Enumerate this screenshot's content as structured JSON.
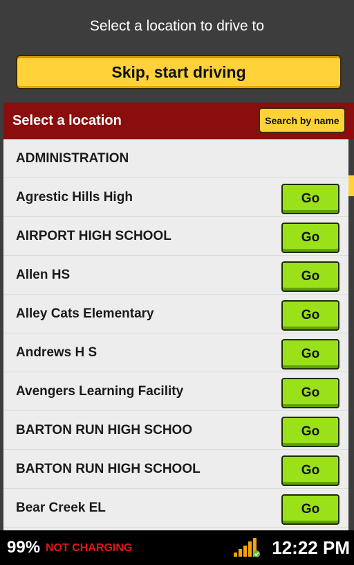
{
  "header": {
    "title": "Select a location to drive to",
    "skip_label": "Skip, start driving"
  },
  "location_bar": {
    "title": "Select a location",
    "search_label": "Search by name"
  },
  "locations": [
    {
      "name": "ADMINISTRATION",
      "go": ""
    },
    {
      "name": "Agrestic Hills High",
      "go": "Go"
    },
    {
      "name": "AIRPORT HIGH SCHOOL",
      "go": "Go"
    },
    {
      "name": "Allen HS",
      "go": "Go"
    },
    {
      "name": "Alley Cats Elementary",
      "go": "Go"
    },
    {
      "name": "Andrews H S",
      "go": "Go"
    },
    {
      "name": "Avengers Learning Facility",
      "go": "Go"
    },
    {
      "name": "BARTON RUN HIGH SCHOO",
      "go": "Go"
    },
    {
      "name": "BARTON RUN HIGH SCHOOL",
      "go": "Go"
    },
    {
      "name": "Bear Creek EL",
      "go": "Go"
    }
  ],
  "status": {
    "battery": "99%",
    "charging": "NOT CHARGING",
    "signal_icon": "signal-bars-icon",
    "time": "12:22 PM"
  },
  "colors": {
    "accent_yellow": "#ffd23a",
    "header_red": "#8b0e0e",
    "go_green": "#9ae11a",
    "alert_red": "#e01818"
  }
}
